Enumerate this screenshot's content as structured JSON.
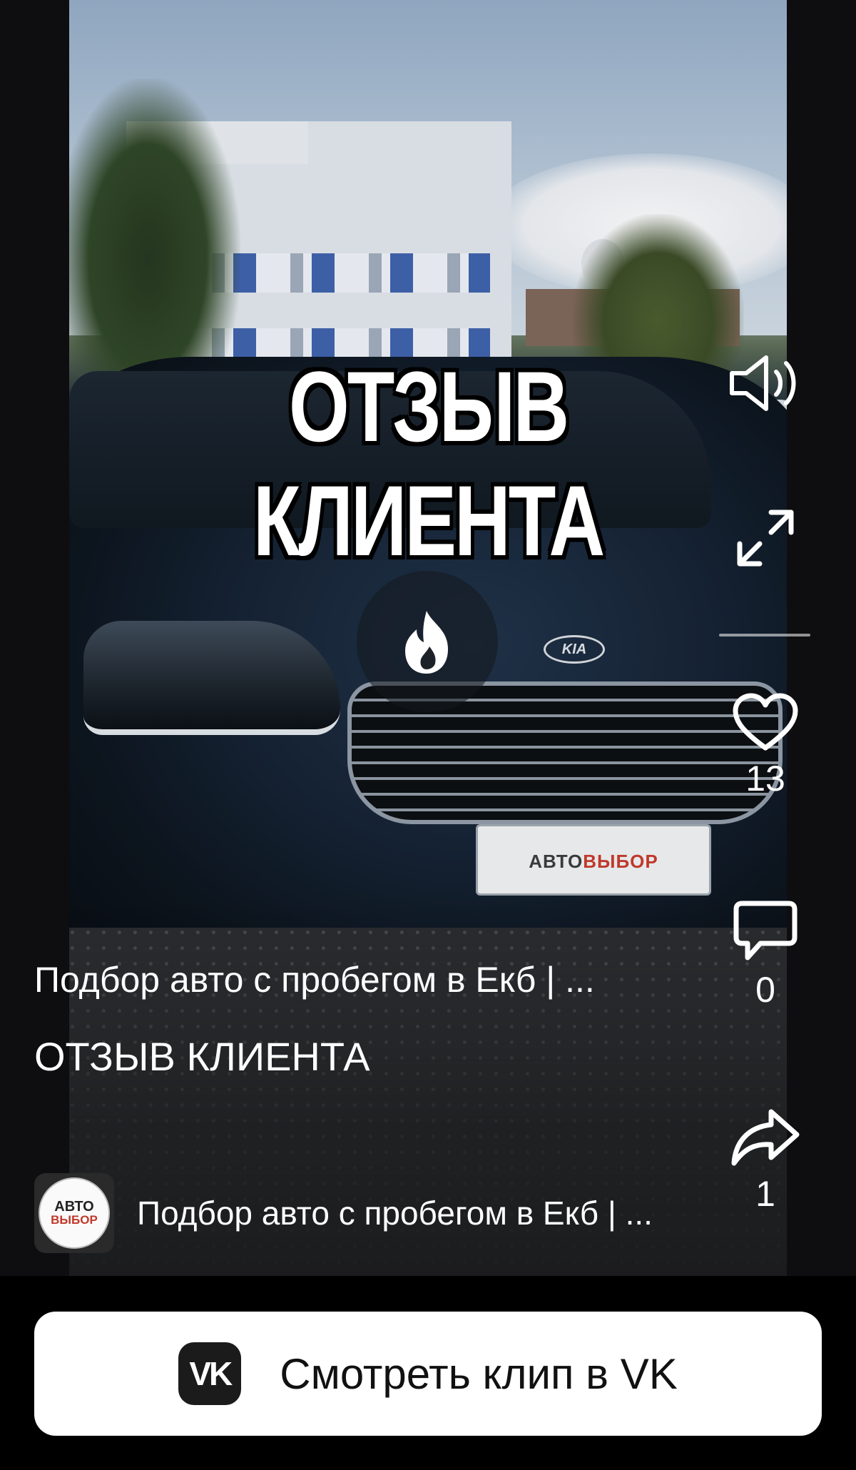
{
  "video": {
    "overlay_title_line1": "ОТЗЫВ",
    "overlay_title_line2": "КЛИЕНТА",
    "plate_text_part1": "АВТО",
    "plate_text_part2": "ВЫБОР",
    "car_logo": "KIA"
  },
  "actions": {
    "sound_icon": "speaker-icon",
    "fullscreen_icon": "expand-icon",
    "like_count": "13",
    "comment_count": "0",
    "share_count": "1"
  },
  "caption": {
    "author_line": "Подбор авто с пробегом в Екб | ...",
    "title": "ОТЗЫВ КЛИЕНТА"
  },
  "author": {
    "avatar_text_line1": "АВТО",
    "avatar_text_line2": "ВЫБОР",
    "name": "Подбор авто с пробегом в Екб | ..."
  },
  "footer": {
    "vk_logo": "VK",
    "watch_label": "Смотреть клип в VK"
  },
  "colors": {
    "background": "#000000",
    "button_bg": "#ffffff",
    "accent_red": "#c0392b"
  }
}
